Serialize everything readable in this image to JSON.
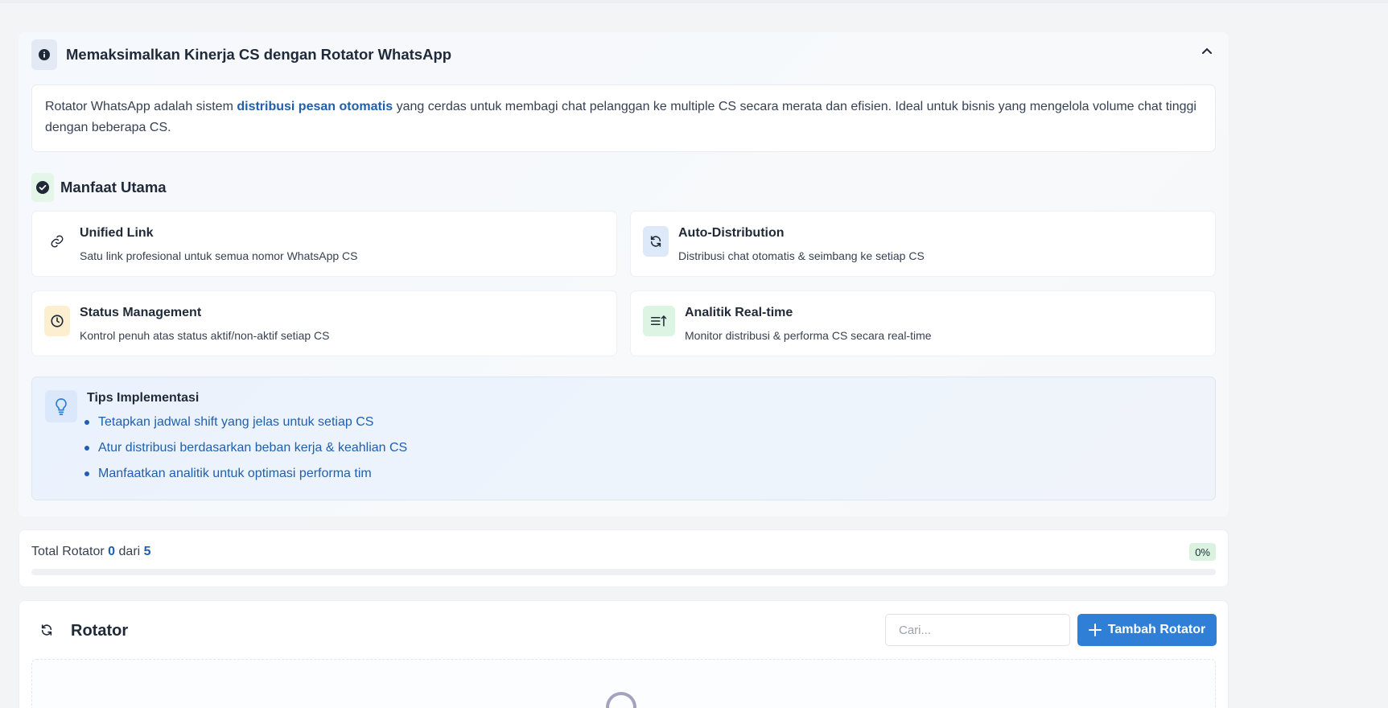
{
  "info": {
    "title": "Memaksimalkan Kinerja CS dengan Rotator WhatsApp",
    "description": {
      "before": "Rotator WhatsApp adalah sistem ",
      "highlight": "distribusi pesan otomatis",
      "after": " yang cerdas untuk membagi chat pelanggan ke multiple CS secara merata dan efisien. Ideal untuk bisnis yang mengelola volume chat tinggi dengan beberapa CS."
    },
    "benefits_title": "Manfaat Utama",
    "features": [
      {
        "title": "Unified Link",
        "desc": "Satu link profesional untuk semua nomor WhatsApp CS",
        "icon": "link-icon"
      },
      {
        "title": "Auto-Distribution",
        "desc": "Distribusi chat otomatis & seimbang ke setiap CS",
        "icon": "refresh-icon"
      },
      {
        "title": "Status Management",
        "desc": "Kontrol penuh atas status aktif/non-aktif setiap CS",
        "icon": "clock-icon"
      },
      {
        "title": "Analitik Real-time",
        "desc": "Monitor distribusi & performa CS secara real-time",
        "icon": "sort-list-icon"
      }
    ],
    "tips": {
      "title": "Tips Implementasi",
      "items": [
        "Tetapkan jadwal shift yang jelas untuk setiap CS",
        "Atur distribusi berdasarkan beban kerja & keahlian CS",
        "Manfaatkan analitik untuk optimasi performa tim"
      ]
    }
  },
  "total": {
    "label": "Total Rotator",
    "current": "0",
    "separator": "dari",
    "max": "5",
    "percent_label": "0%",
    "progress": 0
  },
  "rotator": {
    "title": "Rotator",
    "search_placeholder": "Cari...",
    "add_label": "Tambah Rotator"
  },
  "colors": {
    "primary": "#2f7fd6",
    "link": "#1f5fae",
    "success_bg": "#d9f3e0"
  }
}
